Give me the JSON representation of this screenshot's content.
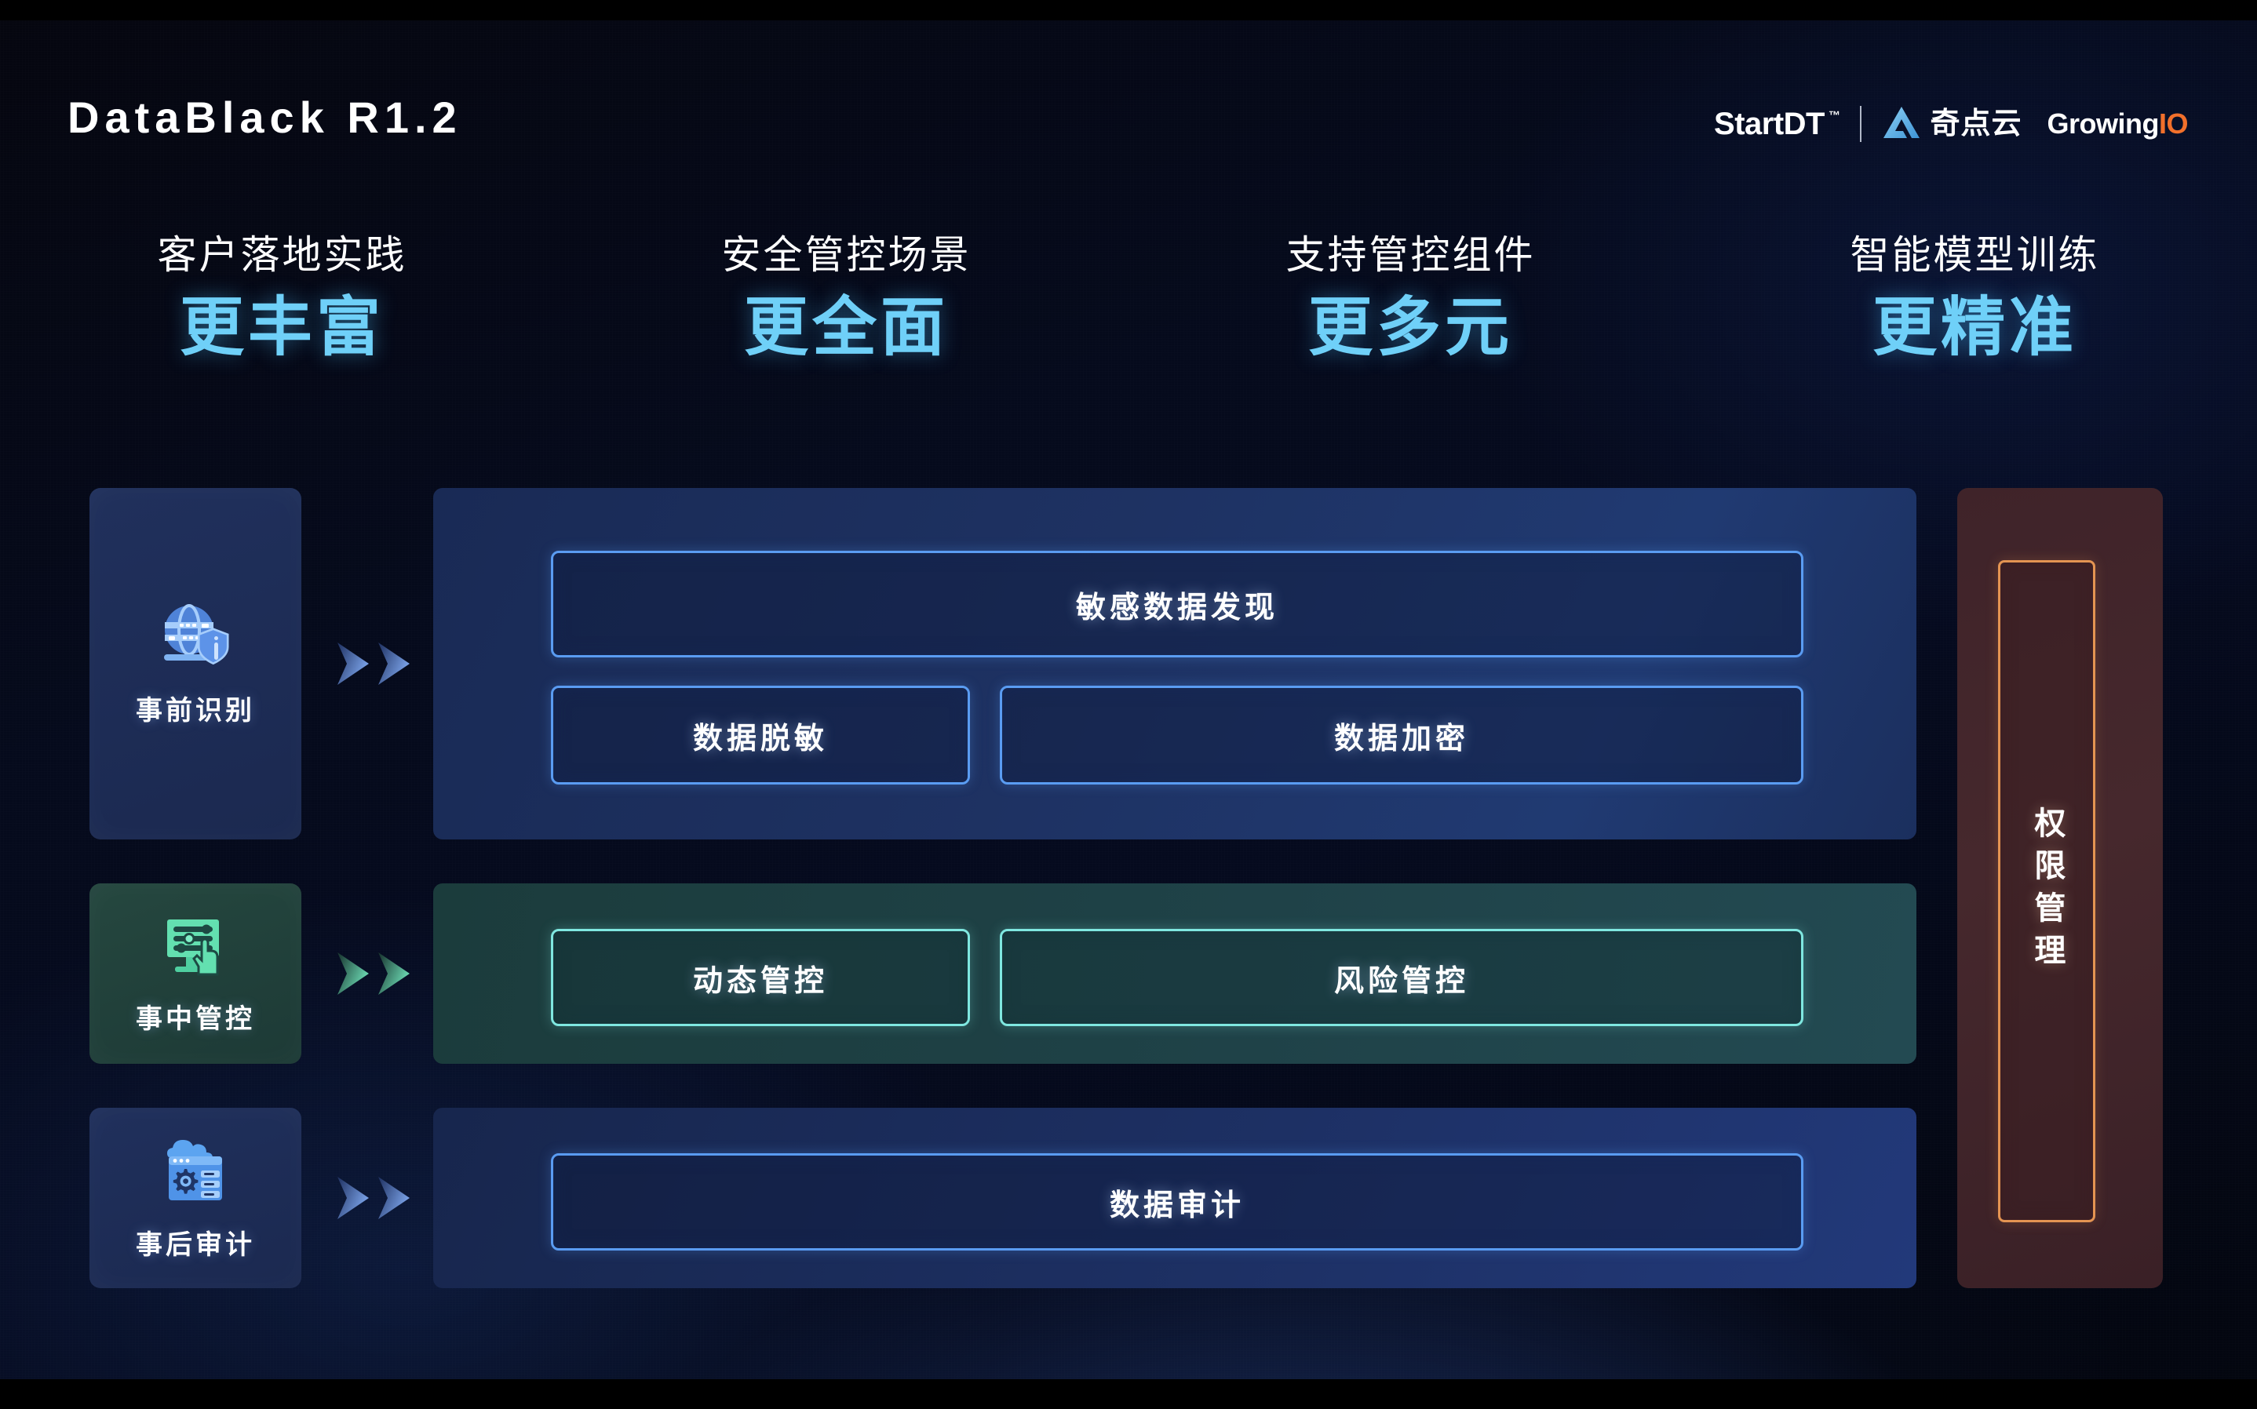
{
  "header": {
    "product_title": "DataBlack R1.2",
    "logos": {
      "startdt": "StartDT",
      "startdt_tm": "™",
      "qidianyun_icon": "triangle-a-logo",
      "qidianyun": "奇点云",
      "growing": "Growing",
      "growing_io": "IO"
    }
  },
  "headlines": [
    {
      "subtitle": "客户落地实践",
      "highlight": "更丰富"
    },
    {
      "subtitle": "安全管控场景",
      "highlight": "更全面"
    },
    {
      "subtitle": "支持管控组件",
      "highlight": "更多元"
    },
    {
      "subtitle": "智能模型训练",
      "highlight": "更精准"
    }
  ],
  "rows": [
    {
      "stage_icon": "globe-shield-icon",
      "stage_label": "事前识别",
      "arrow_icon": "double-chevron-right-icon",
      "arrow_color": "#5a87e0",
      "accent": "#5a9cf2",
      "pills": [
        {
          "label": "敏感数据发现"
        },
        {
          "label": "数据脱敏"
        },
        {
          "label": "数据加密"
        }
      ]
    },
    {
      "stage_icon": "sliders-hand-icon",
      "stage_label": "事中管控",
      "arrow_icon": "double-chevron-right-icon",
      "arrow_color": "#58c9ab",
      "accent": "#7fe7e0",
      "pills": [
        {
          "label": "动态管控"
        },
        {
          "label": "风险管控"
        }
      ]
    },
    {
      "stage_icon": "cloud-audit-gear-icon",
      "stage_label": "事后审计",
      "arrow_icon": "double-chevron-right-icon",
      "arrow_color": "#5a87e0",
      "accent": "#5a9cf2",
      "pills": [
        {
          "label": "数据审计"
        }
      ]
    }
  ],
  "permission": {
    "label": "权限管理",
    "border_color": "#e49452"
  },
  "colors": {
    "background": "#050a1c",
    "highlight_cyan": "#6fd0f8",
    "pill_blue": "#5a9cf2",
    "pill_cyan": "#7fe7e0",
    "permission_orange": "#e49452",
    "growing_io_orange": "#f2702b"
  }
}
